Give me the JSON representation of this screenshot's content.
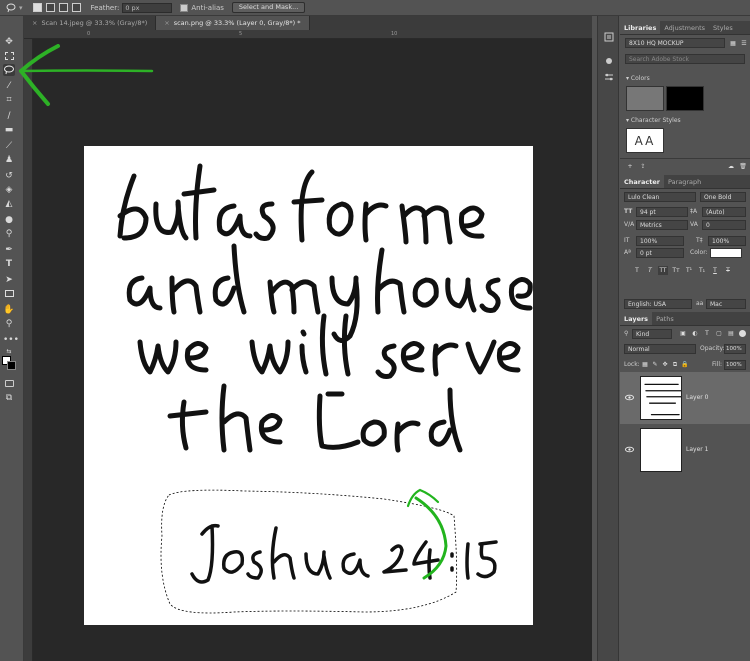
{
  "options_bar": {
    "feather_label": "Feather:",
    "feather_value": "0 px",
    "antialias_label": "Anti-alias",
    "select_mask_label": "Select and Mask..."
  },
  "document_tabs": [
    {
      "label": "Scan 14.jpeg @ 33.3% (Gray/8*)",
      "close": "×",
      "active": false
    },
    {
      "label": "scan.png @ 33.3% (Layer 0, Gray/8*) *",
      "close": "×",
      "active": true
    }
  ],
  "ruler": {
    "top_numbers": [
      "0",
      "5",
      "10"
    ]
  },
  "canvas": {
    "lettering": [
      "but as for me",
      "and my house,",
      "we will serve",
      "the Lord",
      "Joshua 24:15"
    ]
  },
  "libraries_panel": {
    "tabs": [
      "Libraries",
      "Adjustments",
      "Styles"
    ],
    "library_name": "8X10 HQ MOCKUP",
    "search_placeholder": "Search Adobe Stock",
    "colors_heading": "Colors",
    "color_swatches": [
      "#777777",
      "#000000"
    ],
    "character_styles_heading": "Character Styles",
    "char_style_preview": "AA"
  },
  "character_panel": {
    "tabs": [
      "Character",
      "Paragraph"
    ],
    "font_family": "Lulo Clean",
    "font_style": "One Bold",
    "font_size": "94 pt",
    "leading": "(Auto)",
    "kerning": "Metrics",
    "tracking": "0",
    "vertical_scale": "100%",
    "horizontal_scale": "100%",
    "baseline_shift": "0 pt",
    "color_label": "Color:",
    "style_buttons": [
      "T",
      "T",
      "TT",
      "Tт",
      "T¹",
      "T₁",
      "T",
      "T"
    ],
    "language": "English: USA",
    "aa_option": "aa",
    "aa_method": "Mac"
  },
  "layers_panel": {
    "tabs": [
      "Layers",
      "Paths"
    ],
    "filter_kind": "Kind",
    "blend_mode": "Normal",
    "opacity_label": "Opacity:",
    "opacity_value": "100%",
    "lock_label": "Lock:",
    "fill_label": "Fill:",
    "fill_value": "100%",
    "layers": [
      {
        "name": "Layer 0",
        "selected": true
      },
      {
        "name": "Layer 1",
        "selected": false
      }
    ]
  },
  "colors": {
    "annotation_green": "#22b41e",
    "workspace": "#282828",
    "ui_gray": "#535353"
  }
}
